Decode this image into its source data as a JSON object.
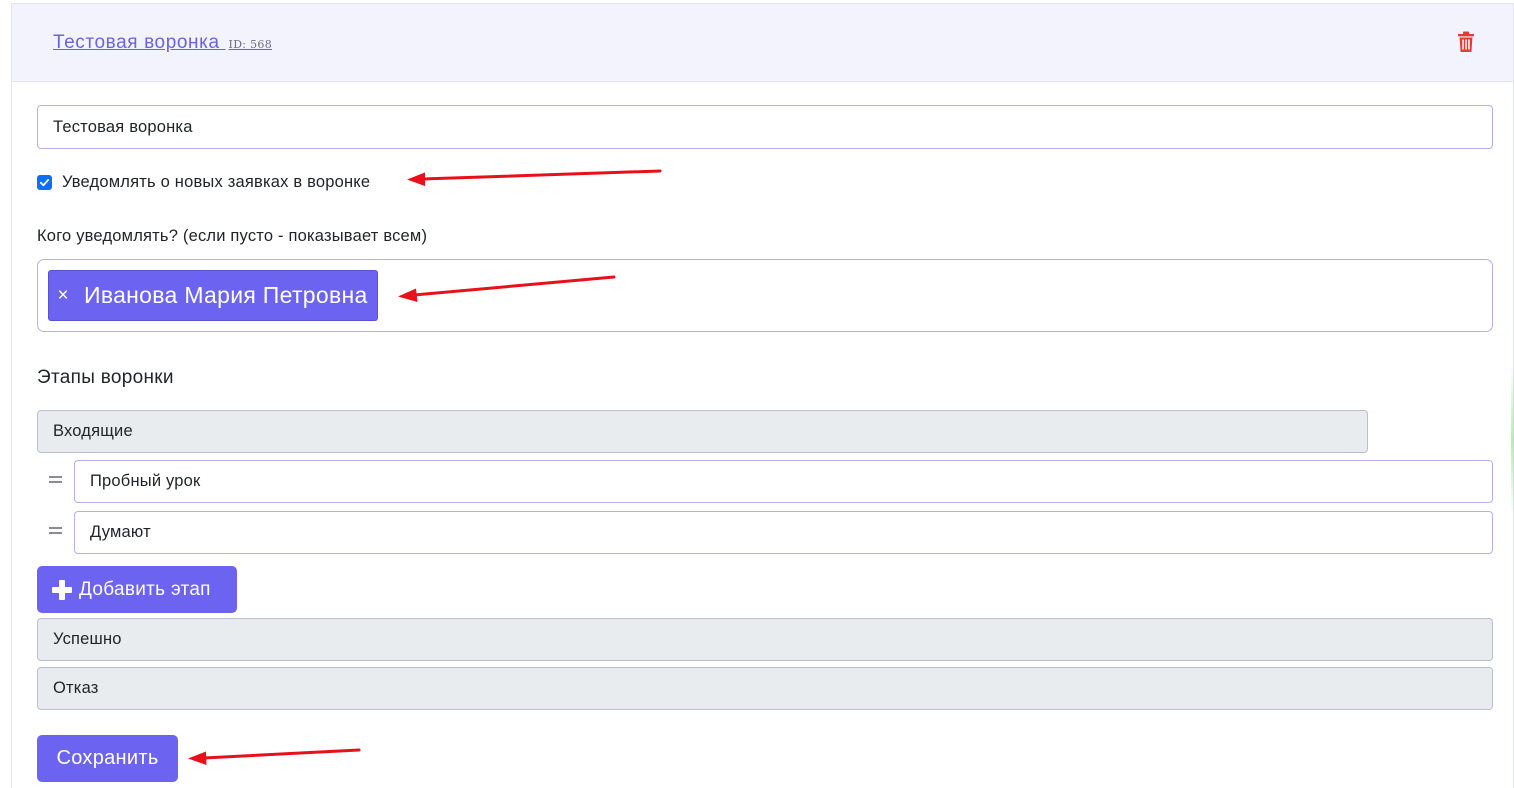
{
  "header": {
    "funnel_title": "Тестовая воронка",
    "funnel_id": "ID: 568",
    "delete_icon": "trash-icon"
  },
  "form": {
    "name_value": "Тестовая воронка",
    "notify_checked": true,
    "notify_label": "Уведомлять о новых заявках в воронке",
    "who_label": "Кого уведомлять? (если пусто - показывает всем)",
    "selected_users": [
      {
        "remove_symbol": "×",
        "name": "Иванова Мария Петровна"
      }
    ]
  },
  "stages": {
    "heading": "Этапы воронки",
    "incoming": "Входящие",
    "editable": [
      "Пробный урок",
      "Думают"
    ],
    "add_label": "Добавить этап",
    "success": "Успешно",
    "refusal": "Отказ"
  },
  "actions": {
    "save_label": "Сохранить"
  },
  "colors": {
    "accent": "#6c63f0",
    "header_bg": "#f3f3fd",
    "delete": "#e53935",
    "annotation_arrow": "#e8101a",
    "checkbox": "#0d6efd"
  }
}
